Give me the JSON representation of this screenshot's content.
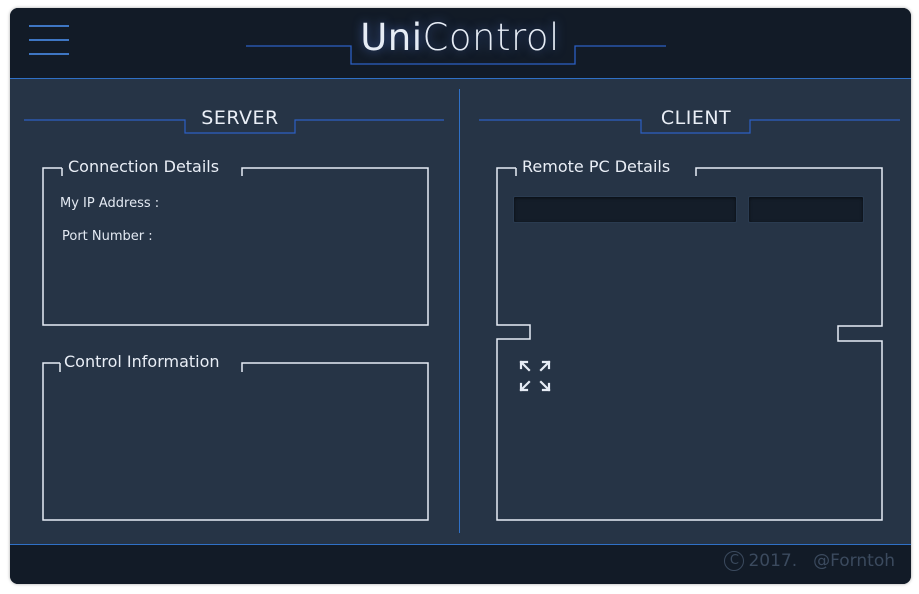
{
  "app": {
    "title_bold": "Uni",
    "title_light": "Control"
  },
  "server": {
    "heading": "SERVER",
    "connection_details": {
      "label": "Connection Details",
      "ip_label": "My IP Address :",
      "port_label": "Port Number  :"
    },
    "control_information": {
      "label": "Control Information"
    }
  },
  "client": {
    "heading": "CLIENT",
    "remote_pc_details": {
      "label": "Remote PC Details",
      "ip_input_value": "",
      "port_input_value": ""
    }
  },
  "footer": {
    "copyright_symbol": "C",
    "year": "2017.",
    "author": "@Forntoh"
  },
  "colors": {
    "background": "#263446",
    "header_bg": "#121b27",
    "accent": "#2f70c6",
    "frame": "#e6ecf5"
  },
  "icons": [
    "menu-icon",
    "expand-icon",
    "copyright-icon"
  ]
}
